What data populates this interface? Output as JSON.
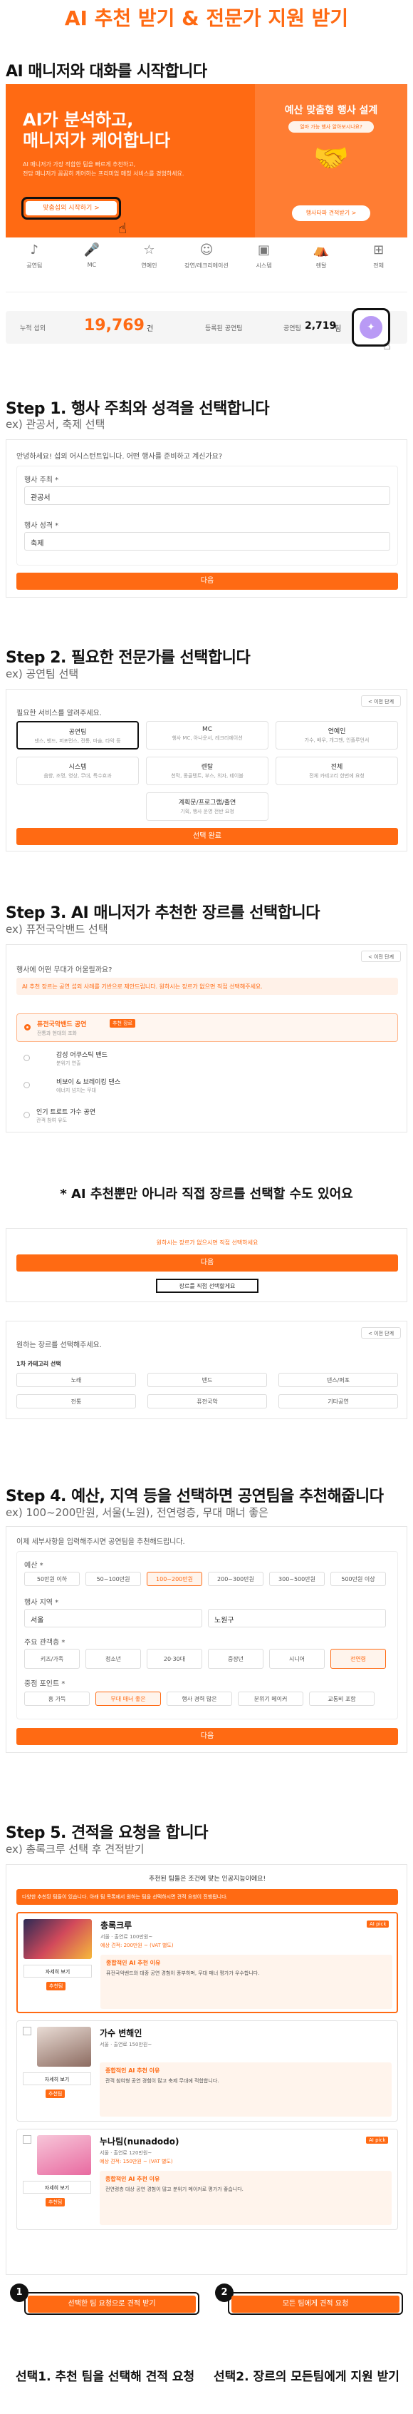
{
  "header": {
    "title": "AI 추천 받기 & 전문가 지원 받기"
  },
  "intro": {
    "heading": "AI 매니저와 대화를 시작합니다",
    "banner_title": "AI가 분석하고,\n매니저가 케어합니다",
    "banner_desc": "AI 매니저가 가장 적합한 팀을 빠르게 추천하고,\n전담 매니저가 꼼꼼히 케어하는 프리미엄 매칭 서비스를 경험하세요.",
    "banner_button": "맞춤섭외 시작하기 >",
    "right_title": "예산 맞춤형 행사 설계",
    "right_badge": "얼마 가능 행사 알아보시나요?",
    "right_button": "행사타파 견적받기 >",
    "categories": [
      "공연팀",
      "MC",
      "연예인",
      "강연/레크리에이션",
      "시스템",
      "렌탈",
      "전체"
    ],
    "stats": {
      "label1": "누적 섭외",
      "value1": "19,769",
      "unit1": "건",
      "label2": "등록된 공연팀",
      "label3": "공연팀",
      "value3": "2,719",
      "unit3": "팀"
    }
  },
  "step1": {
    "title": "Step 1. 행사 주최와 성격을 선택합니다",
    "sub": "ex) 관공서, 축제 선택",
    "prompt": "안녕하세요! 섭외 어시스턴트입니다. 어떤 행사를 준비하고 계신가요?",
    "field1": "행사 주최 *",
    "value1": "관공서",
    "field2": "행사 성격 *",
    "value2": "축제",
    "button": "다음"
  },
  "step2": {
    "title": "Step 2. 필요한 전문가를 선택합니다",
    "sub": "ex) 공연팀 선택",
    "prompt": "필요한 서비스를 알려주세요.",
    "back": "< 이전 단계",
    "cards": [
      {
        "t": "공연팀",
        "s": "댄스, 밴드, 퍼포먼스, 전통, 마술, 타악 등"
      },
      {
        "t": "MC",
        "s": "행사 MC, 아나운서, 레크리에이션"
      },
      {
        "t": "연예인",
        "s": "가수, 배우, 개그맨, 인플루언서"
      },
      {
        "t": "시스템",
        "s": "음향, 조명, 영상, 무대, 특수효과"
      },
      {
        "t": "렌탈",
        "s": "천막, 몽골텐트, 부스, 의자, 테이블"
      },
      {
        "t": "전체",
        "s": "전체 카테고리 한번에 요청"
      },
      {
        "t": "계획문/프로그램/출연",
        "s": "기획, 행사 운영 전반 요청"
      }
    ],
    "button": "선택 완료"
  },
  "step3": {
    "title": "Step 3. AI 매니저가 추천한 장르를 선택합니다",
    "sub": "ex) 퓨전국악밴드 선택",
    "back": "< 이전 단계",
    "prompt": "행사에 어떤 무대가 어울릴까요?",
    "notice": "AI 추천 장르는 공연 섭외 사례를 기반으로 제안드립니다. 원하시는 장르가 없으면 직접 선택해주세요.",
    "options": [
      {
        "t": "퓨전국악밴드 공연",
        "tag": "추천 장르",
        "s": "전통과 현대의 조화"
      },
      {
        "t": "감성 어쿠스틱 밴드",
        "tag": "",
        "s": "분위기 연출"
      },
      {
        "t": "비보이 & 브레이킹 댄스",
        "tag": "",
        "s": "에너지 넘치는 무대"
      },
      {
        "t": "인기 트로트 가수 공연",
        "tag": "",
        "s": "관객 참여 유도"
      }
    ],
    "note": "* AI 추천뿐만 아니라 직접 장르를 선택할 수도 있어요",
    "alt_prompt": "원하시는 장르가 없으시면 직접 선택하세요",
    "alt_button": "다음",
    "alt_link": "장르를 직접 선택할게요",
    "genre_prompt": "원하는 장르를 선택해주세요.",
    "genre_header": "1차 카테고리 선택",
    "genres": [
      "노래",
      "밴드",
      "댄스/퍼포",
      "전통",
      "퓨전국악",
      "기타공연"
    ]
  },
  "step4": {
    "title": "Step 4. 예산, 지역 등을 선택하면 공연팀을 추천해줍니다",
    "sub": "ex) 100~200만원, 서울(노원), 전연령층, 무대 매너 좋은",
    "prompt": "이제 세부사항을 입력해주시면 공연팀을 추천해드립니다.",
    "budget_label": "예산 *",
    "budgets": [
      "50만원 이하",
      "50~100만원",
      "100~200만원",
      "200~300만원",
      "300~500만원",
      "500만원 이상"
    ],
    "region_label": "행사 지역 *",
    "region1": "서울",
    "region2": "노원구",
    "audience_label": "주요 관객층 *",
    "audiences": [
      "키즈/가족",
      "청소년",
      "20·30대",
      "중장년",
      "시니어",
      "전연령"
    ],
    "focus_label": "중점 포인트 *",
    "focuses": [
      "흥 가득",
      "무대 매너 좋은",
      "행사 경력 많은",
      "분위기 메이커",
      "교통비 포함"
    ],
    "button": "다음"
  },
  "step5": {
    "title": "Step 5. 견적을 요청을 합니다",
    "sub": "ex) 총록크루 선택 후 견적받기",
    "header": "추천된 팀들은 조건에 맞는 인공지능이에요!",
    "notice": "다양한 추천된 팀들이 있습니다. 아래 팀 목록에서 원하는 팀을 선택하시면 견적 요청이 진행됩니다.",
    "teams": [
      {
        "name": "총록크루",
        "area": "서울 · 출연료 100만원~",
        "price": "예상 견적: 200만원 ~ (VAT 별도)",
        "reason_t": "종합적인 AI 추천 이유",
        "reason": "퓨전국악밴드와 대중 공연 경험이 풍부하며, 무대 매너 평가가 우수합니다."
      },
      {
        "name": "가수 변해인",
        "area": "서울 · 출연료 150만원~",
        "price": "",
        "reason_t": "종합적인 AI 추천 이유",
        "reason": "관객 참여형 공연 경험이 많고 축제 무대에 적합합니다."
      },
      {
        "name": "누나팀(nunadodo)",
        "area": "서울 · 출연료 120만원~",
        "price": "예상 견적: 150만원 ~ (VAT 별도)",
        "reason_t": "종합적인 AI 추천 이유",
        "reason": "전연령층 대상 공연 경험이 많고 분위기 메이커로 평가가 좋습니다."
      }
    ],
    "view": "자세히 보기",
    "pick": "추천팀",
    "label": "AI pick",
    "btn1": "선택한 팀 요청으로 견적 받기",
    "btn2": "모든 팀에게 견적 요청",
    "cap1": "선택1. 추천 팀을 선택해 견적 요청",
    "cap2": "선택2. 장르의 모든팀에게 지원 받기"
  },
  "colors": {
    "accent": "#ff6a13",
    "dark": "#111111"
  }
}
